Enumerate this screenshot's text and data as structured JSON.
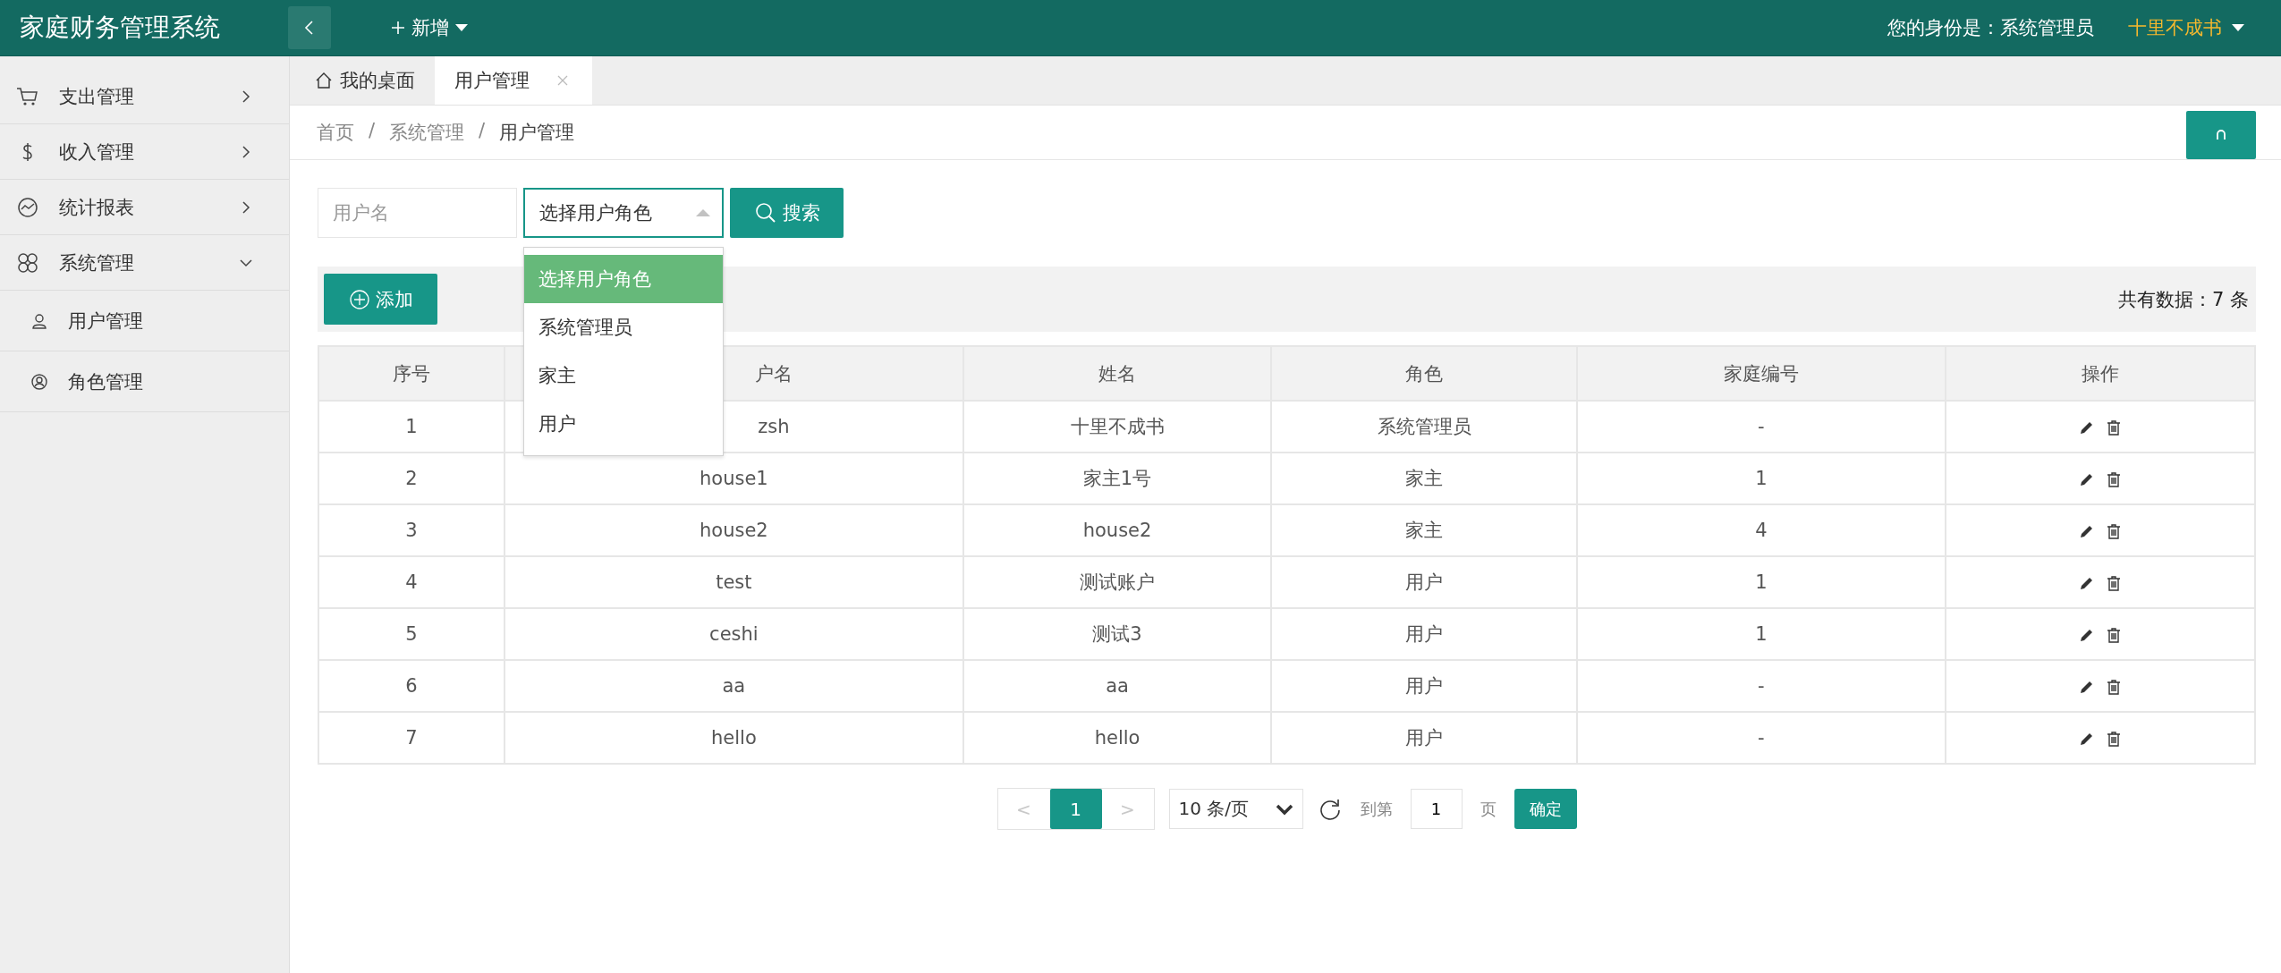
{
  "header": {
    "title": "家庭财务管理系统",
    "new_label": "新增",
    "identity": "您的身份是：系统管理员",
    "user": "十里不成书"
  },
  "sidebar": {
    "items": [
      {
        "label": "支出管理",
        "expanded": false
      },
      {
        "label": "收入管理",
        "expanded": false
      },
      {
        "label": "统计报表",
        "expanded": false
      },
      {
        "label": "系统管理",
        "expanded": true,
        "children": [
          {
            "label": "用户管理"
          },
          {
            "label": "角色管理"
          }
        ]
      }
    ]
  },
  "tabs": [
    {
      "label": "我的桌面",
      "selected": false
    },
    {
      "label": "用户管理",
      "selected": true
    }
  ],
  "breadcrumb": {
    "separator": "/",
    "items": [
      "首页",
      "系统管理",
      "用户管理"
    ]
  },
  "search": {
    "username_placeholder": "用户名",
    "role_select": {
      "value": "选择用户角色",
      "expanded": true,
      "options": [
        {
          "label": "选择用户角色",
          "selected": true
        },
        {
          "label": "系统管理员",
          "selected": false
        },
        {
          "label": "家主",
          "selected": false
        },
        {
          "label": "用户",
          "selected": false
        }
      ]
    },
    "button": "搜索"
  },
  "toolbar": {
    "add": "添加",
    "total": "共有数据：7 条"
  },
  "table": {
    "columns": [
      "序号",
      "户名",
      "姓名",
      "角色",
      "家庭编号",
      "操作"
    ],
    "rows": [
      [
        "1",
        "zsh",
        "十里不成书",
        "系统管理员",
        "-"
      ],
      [
        "2",
        "house1",
        "家主1号",
        "家主",
        "1"
      ],
      [
        "3",
        "house2",
        "house2",
        "家主",
        "4"
      ],
      [
        "4",
        "test",
        "测试账户",
        "用户",
        "1"
      ],
      [
        "5",
        "ceshi",
        "测试3",
        "用户",
        "1"
      ],
      [
        "6",
        "aa",
        "aa",
        "用户",
        "-"
      ],
      [
        "7",
        "hello",
        "hello",
        "用户",
        "-"
      ]
    ]
  },
  "pagination": {
    "prev": "<",
    "pages": [
      {
        "label": "1",
        "selected": true
      }
    ],
    "next": ">",
    "page_size": "10 条/页",
    "goto": "到第",
    "page_input": "1",
    "page_unit": "页",
    "confirm": "确定"
  }
}
